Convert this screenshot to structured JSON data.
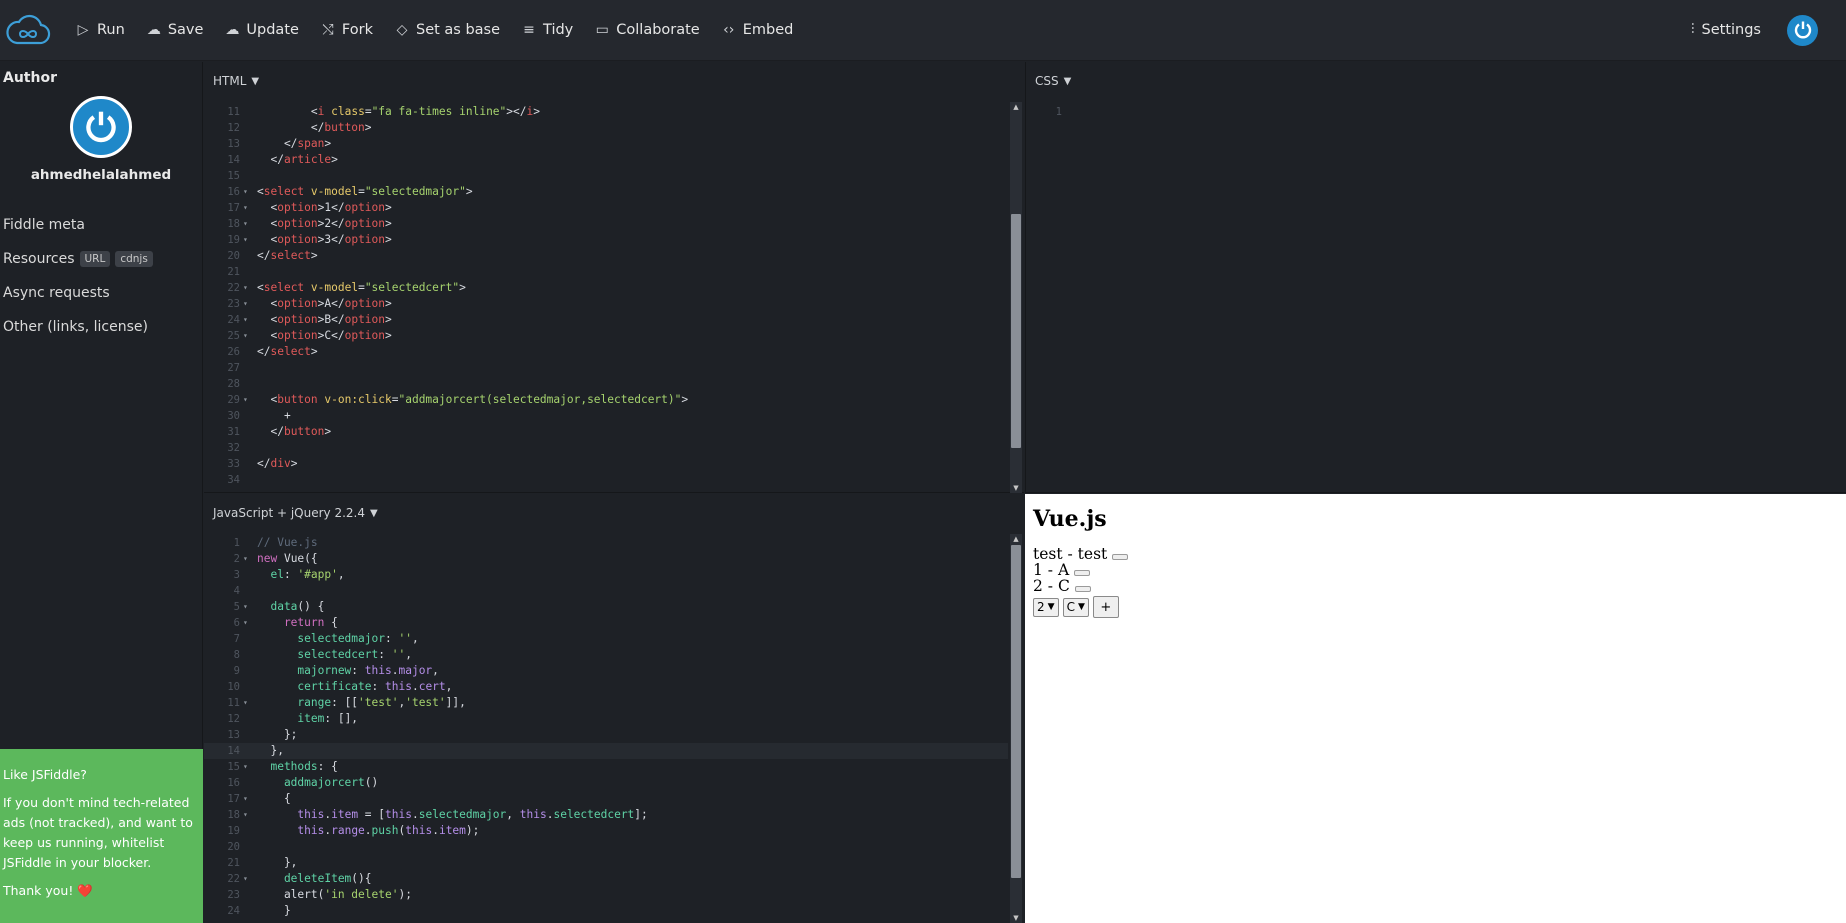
{
  "toolbar": {
    "run": "Run",
    "save": "Save",
    "update": "Update",
    "fork": "Fork",
    "set_as_base": "Set as base",
    "tidy": "Tidy",
    "collaborate": "Collaborate",
    "embed": "Embed",
    "settings": "Settings"
  },
  "sidebar": {
    "author_heading": "Author",
    "username": "ahmedhelalahmed",
    "fiddle_meta": "Fiddle meta",
    "resources": "Resources",
    "resources_badge_url": "URL",
    "resources_badge_cdnjs": "cdnjs",
    "async_requests": "Async requests",
    "other": "Other (links, license)",
    "ad": {
      "title": "Like JSFiddle?",
      "body": "If you don't mind tech-related ads (not tracked), and want to keep us running, whitelist JSFiddle in your blocker.",
      "thanks": "Thank you!",
      "heart": "❤️"
    }
  },
  "panels": {
    "html_label": "HTML",
    "css_label": "CSS",
    "js_label": "JavaScript + jQuery 2.2.4"
  },
  "html_lines": [
    {
      "n": "11",
      "f": "",
      "segs": [
        [
          "        ",
          ""
        ],
        [
          "<",
          ""
        ],
        [
          "i",
          "t"
        ],
        [
          " class",
          "a"
        ],
        [
          "=",
          ""
        ],
        [
          "\"fa fa-times inline\"",
          "s"
        ],
        [
          "></",
          ""
        ],
        [
          "i",
          "t"
        ],
        [
          ">",
          ""
        ]
      ]
    },
    {
      "n": "12",
      "f": "",
      "segs": [
        [
          "        </",
          ""
        ],
        [
          "button",
          "t"
        ],
        [
          ">",
          ""
        ]
      ]
    },
    {
      "n": "13",
      "f": "",
      "segs": [
        [
          "    </",
          ""
        ],
        [
          "span",
          "t"
        ],
        [
          ">",
          ""
        ]
      ]
    },
    {
      "n": "14",
      "f": "",
      "segs": [
        [
          "  </",
          ""
        ],
        [
          "article",
          "t"
        ],
        [
          ">",
          ""
        ]
      ]
    },
    {
      "n": "15",
      "f": "",
      "segs": []
    },
    {
      "n": "16",
      "f": "▾",
      "segs": [
        [
          "<",
          ""
        ],
        [
          "select",
          "t"
        ],
        [
          " v-model",
          "a"
        ],
        [
          "=",
          ""
        ],
        [
          "\"selectedmajor\"",
          "s"
        ],
        [
          ">",
          ""
        ]
      ]
    },
    {
      "n": "17",
      "f": "▾",
      "segs": [
        [
          "  <",
          ""
        ],
        [
          "option",
          "t"
        ],
        [
          ">1</",
          ""
        ],
        [
          "option",
          "t"
        ],
        [
          ">",
          ""
        ]
      ]
    },
    {
      "n": "18",
      "f": "▾",
      "segs": [
        [
          "  <",
          ""
        ],
        [
          "option",
          "t"
        ],
        [
          ">2</",
          ""
        ],
        [
          "option",
          "t"
        ],
        [
          ">",
          ""
        ]
      ]
    },
    {
      "n": "19",
      "f": "▾",
      "segs": [
        [
          "  <",
          ""
        ],
        [
          "option",
          "t"
        ],
        [
          ">3</",
          ""
        ],
        [
          "option",
          "t"
        ],
        [
          ">",
          ""
        ]
      ]
    },
    {
      "n": "20",
      "f": "",
      "segs": [
        [
          "</",
          ""
        ],
        [
          "select",
          "t"
        ],
        [
          ">",
          ""
        ]
      ]
    },
    {
      "n": "21",
      "f": "",
      "segs": []
    },
    {
      "n": "22",
      "f": "▾",
      "segs": [
        [
          "<",
          ""
        ],
        [
          "select",
          "t"
        ],
        [
          " v-model",
          "a"
        ],
        [
          "=",
          ""
        ],
        [
          "\"selectedcert\"",
          "s"
        ],
        [
          ">",
          ""
        ]
      ]
    },
    {
      "n": "23",
      "f": "▾",
      "segs": [
        [
          "  <",
          ""
        ],
        [
          "option",
          "t"
        ],
        [
          ">A</",
          ""
        ],
        [
          "option",
          "t"
        ],
        [
          ">",
          ""
        ]
      ]
    },
    {
      "n": "24",
      "f": "▾",
      "segs": [
        [
          "  <",
          ""
        ],
        [
          "option",
          "t"
        ],
        [
          ">B</",
          ""
        ],
        [
          "option",
          "t"
        ],
        [
          ">",
          ""
        ]
      ]
    },
    {
      "n": "25",
      "f": "▾",
      "segs": [
        [
          "  <",
          ""
        ],
        [
          "option",
          "t"
        ],
        [
          ">C</",
          ""
        ],
        [
          "option",
          "t"
        ],
        [
          ">",
          ""
        ]
      ]
    },
    {
      "n": "26",
      "f": "",
      "segs": [
        [
          "</",
          ""
        ],
        [
          "select",
          "t"
        ],
        [
          ">",
          ""
        ]
      ]
    },
    {
      "n": "27",
      "f": "",
      "segs": []
    },
    {
      "n": "28",
      "f": "",
      "segs": []
    },
    {
      "n": "29",
      "f": "▾",
      "segs": [
        [
          "  <",
          ""
        ],
        [
          "button",
          "t"
        ],
        [
          " v-on:click",
          "a"
        ],
        [
          "=",
          ""
        ],
        [
          "\"addmajorcert(selectedmajor,selectedcert)\"",
          "s"
        ],
        [
          ">",
          ""
        ]
      ]
    },
    {
      "n": "30",
      "f": "",
      "segs": [
        [
          "    +",
          ""
        ]
      ]
    },
    {
      "n": "31",
      "f": "",
      "segs": [
        [
          "  </",
          ""
        ],
        [
          "button",
          "t"
        ],
        [
          ">",
          ""
        ]
      ]
    },
    {
      "n": "32",
      "f": "",
      "segs": []
    },
    {
      "n": "33",
      "f": "",
      "segs": [
        [
          "</",
          ""
        ],
        [
          "div",
          "t"
        ],
        [
          ">",
          ""
        ]
      ]
    },
    {
      "n": "34",
      "f": "",
      "segs": []
    }
  ],
  "css_lines": [
    {
      "n": "1",
      "f": "",
      "segs": []
    }
  ],
  "js_lines": [
    {
      "n": "1",
      "f": "",
      "segs": [
        [
          "// Vue.js",
          "c"
        ]
      ]
    },
    {
      "n": "2",
      "f": "▾",
      "segs": [
        [
          "new",
          "k"
        ],
        [
          " Vue({",
          ""
        ]
      ]
    },
    {
      "n": "3",
      "f": "",
      "segs": [
        [
          "  el",
          "p"
        ],
        [
          ": ",
          ""
        ],
        [
          "'#app'",
          "s"
        ],
        [
          ",",
          ""
        ]
      ]
    },
    {
      "n": "4",
      "f": "",
      "segs": []
    },
    {
      "n": "5",
      "f": "▾",
      "segs": [
        [
          "  data",
          "p"
        ],
        [
          "() {",
          ""
        ]
      ]
    },
    {
      "n": "6",
      "f": "▾",
      "segs": [
        [
          "    return",
          "k"
        ],
        [
          " {",
          ""
        ]
      ]
    },
    {
      "n": "7",
      "f": "",
      "segs": [
        [
          "      selectedmajor",
          "p"
        ],
        [
          ": ",
          ""
        ],
        [
          "''",
          "s"
        ],
        [
          ",",
          ""
        ]
      ]
    },
    {
      "n": "8",
      "f": "",
      "segs": [
        [
          "      selectedcert",
          "p"
        ],
        [
          ": ",
          ""
        ],
        [
          "''",
          "s"
        ],
        [
          ",",
          ""
        ]
      ]
    },
    {
      "n": "9",
      "f": "",
      "segs": [
        [
          "      majornew",
          "p"
        ],
        [
          ": ",
          ""
        ],
        [
          "this",
          "v"
        ],
        [
          ".",
          ""
        ],
        [
          "major",
          "v"
        ],
        [
          ",",
          ""
        ]
      ]
    },
    {
      "n": "10",
      "f": "",
      "segs": [
        [
          "      certificate",
          "p"
        ],
        [
          ": ",
          ""
        ],
        [
          "this",
          "v"
        ],
        [
          ".",
          ""
        ],
        [
          "cert",
          "v"
        ],
        [
          ",",
          ""
        ]
      ]
    },
    {
      "n": "11",
      "f": "▾",
      "segs": [
        [
          "      range",
          "p"
        ],
        [
          ": [[",
          ""
        ],
        [
          "'test'",
          "s"
        ],
        [
          ",",
          ""
        ],
        [
          "'test'",
          "s"
        ],
        [
          "]],",
          ""
        ]
      ]
    },
    {
      "n": "12",
      "f": "",
      "segs": [
        [
          "      item",
          "p"
        ],
        [
          ": [],",
          ""
        ]
      ]
    },
    {
      "n": "13",
      "f": "",
      "segs": [
        [
          "    };",
          ""
        ]
      ]
    },
    {
      "n": "14",
      "f": "",
      "active": true,
      "segs": [
        [
          "  },",
          ""
        ]
      ]
    },
    {
      "n": "15",
      "f": "▾",
      "segs": [
        [
          "  methods",
          "p"
        ],
        [
          ": {",
          ""
        ]
      ]
    },
    {
      "n": "16",
      "f": "",
      "segs": [
        [
          "    addmajorcert",
          "p"
        ],
        [
          "()",
          ""
        ]
      ]
    },
    {
      "n": "17",
      "f": "▾",
      "segs": [
        [
          "    {",
          ""
        ]
      ]
    },
    {
      "n": "18",
      "f": "▾",
      "segs": [
        [
          "      this",
          "v"
        ],
        [
          ".",
          ""
        ],
        [
          "item",
          "v"
        ],
        [
          " = [",
          ""
        ],
        [
          "this",
          "v"
        ],
        [
          ".",
          ""
        ],
        [
          "selectedmajor",
          "p"
        ],
        [
          ", ",
          ""
        ],
        [
          "this",
          "v"
        ],
        [
          ".",
          ""
        ],
        [
          "selectedcert",
          "p"
        ],
        [
          "];",
          ""
        ]
      ]
    },
    {
      "n": "19",
      "f": "",
      "segs": [
        [
          "      this",
          "v"
        ],
        [
          ".",
          ""
        ],
        [
          "range",
          "v"
        ],
        [
          ".",
          ""
        ],
        [
          "push",
          "p"
        ],
        [
          "(",
          ""
        ],
        [
          "this",
          "v"
        ],
        [
          ".",
          ""
        ],
        [
          "item",
          "v"
        ],
        [
          ");",
          ""
        ]
      ]
    },
    {
      "n": "20",
      "f": "",
      "segs": []
    },
    {
      "n": "21",
      "f": "",
      "segs": [
        [
          "    },",
          ""
        ]
      ]
    },
    {
      "n": "22",
      "f": "▾",
      "segs": [
        [
          "    deleteItem",
          "p"
        ],
        [
          "(){",
          ""
        ]
      ]
    },
    {
      "n": "23",
      "f": "",
      "segs": [
        [
          "    alert(",
          ""
        ],
        [
          "'in delete'",
          "s"
        ],
        [
          ");",
          ""
        ]
      ]
    },
    {
      "n": "24",
      "f": "",
      "segs": [
        [
          "    }",
          ""
        ]
      ]
    }
  ],
  "result": {
    "heading": "Vue.js",
    "rows": [
      "test - test",
      "1 - A",
      "2 - C"
    ],
    "select_major": "2",
    "select_cert": "C",
    "add_button": "+"
  },
  "colors": {
    "accent": "#1f88c9",
    "ad_background": "#5cb85c"
  }
}
